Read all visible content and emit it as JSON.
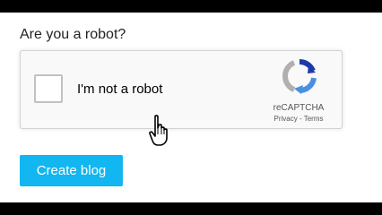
{
  "page": {
    "question": "Are you a robot?",
    "submit_label": "Create blog"
  },
  "recaptcha": {
    "checkbox_label": "I'm not a robot",
    "brand": "reCAPTCHA",
    "privacy_link": "Privacy",
    "separator": " - ",
    "terms_link": "Terms",
    "checked": false
  },
  "colors": {
    "button_bg": "#12b6f0",
    "logo_blue_dark": "#1c3aa9",
    "logo_blue_light": "#4a90e2",
    "logo_gray": "#b0b0b0"
  },
  "icons": {
    "recaptcha_logo": "recaptcha-logo-icon",
    "cursor": "hand-pointer-cursor-icon"
  }
}
